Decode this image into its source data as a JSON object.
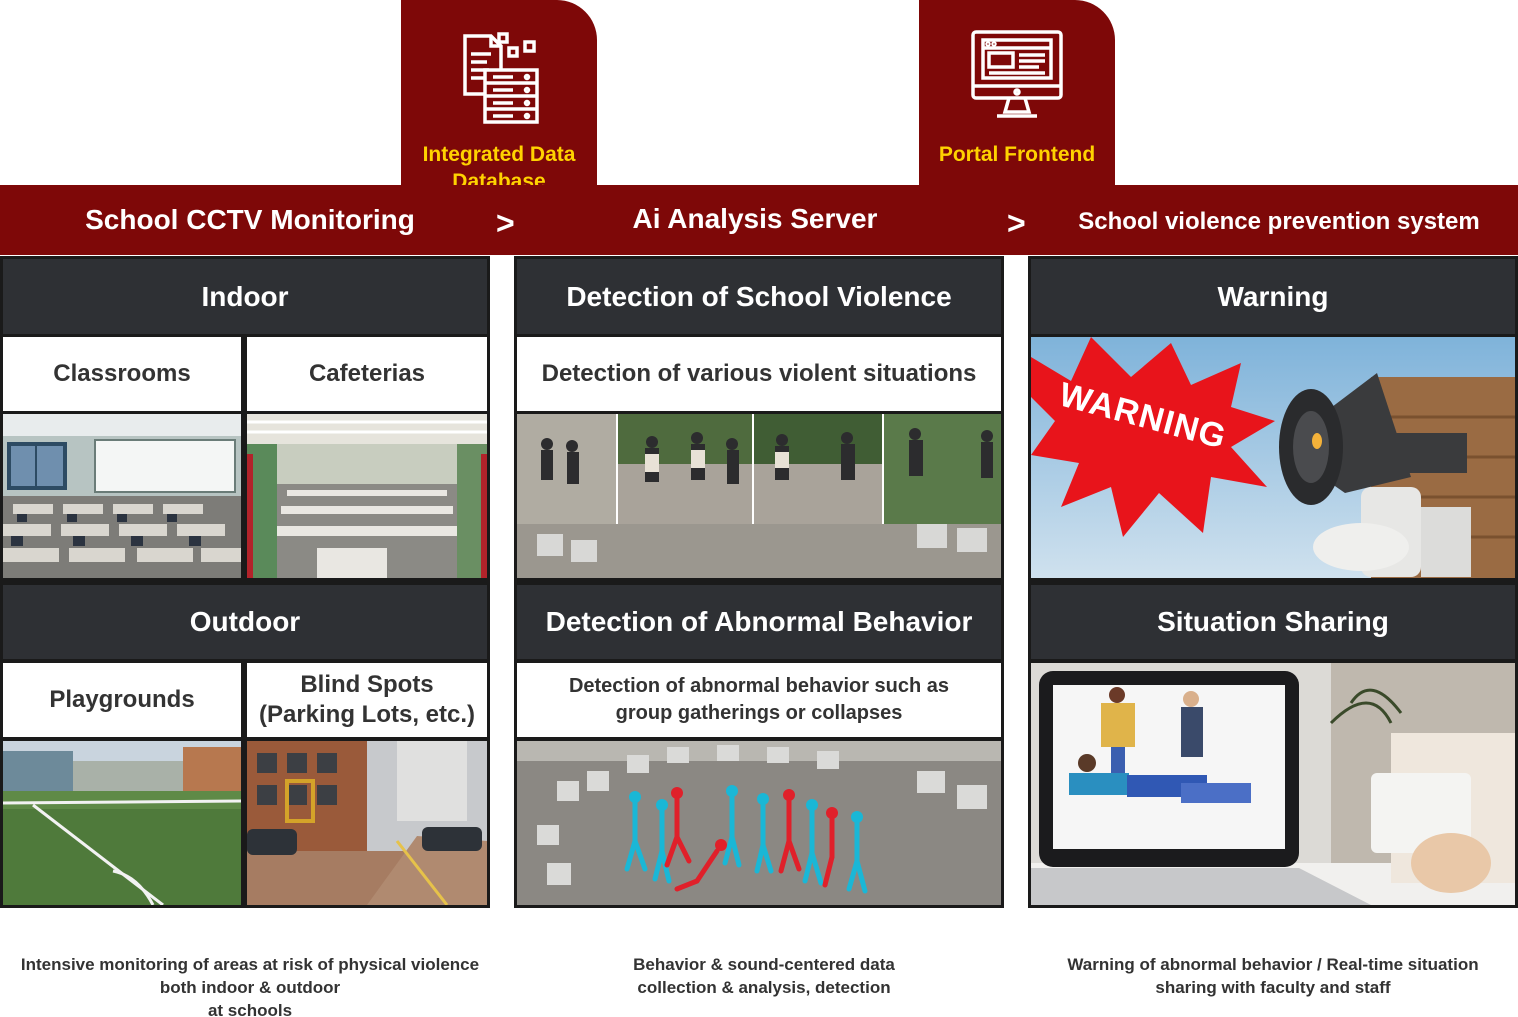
{
  "tabs": [
    {
      "label_line1": "Integrated Data",
      "label_line2": "Database",
      "icon": "database-document-icon"
    },
    {
      "label": "Portal Frontend",
      "icon": "monitor-icon"
    }
  ],
  "header": {
    "col1_title": "School CCTV Monitoring",
    "col2_title": "Ai Analysis Server",
    "col3_title": "School violence prevention system",
    "arrow": ">"
  },
  "col1": {
    "indoor": {
      "title": "Indoor",
      "items": [
        "Classrooms",
        "Cafeterias"
      ]
    },
    "outdoor": {
      "title": "Outdoor",
      "items": [
        "Playgrounds"
      ],
      "blind_line1": "Blind Spots",
      "blind_line2": "(Parking Lots, etc.)"
    },
    "caption_line1": "Intensive monitoring of areas at risk of physical violence",
    "caption_line2": "both indoor & outdoor",
    "caption_line3": "at schools"
  },
  "col2": {
    "violence": {
      "title": "Detection of School Violence",
      "desc": "Detection of various violent situations"
    },
    "abnormal": {
      "title": "Detection of Abnormal Behavior",
      "desc_line1": "Detection of abnormal behavior such as",
      "desc_line2": "group gatherings or collapses"
    },
    "caption_line1": "Behavior & sound-centered data",
    "caption_line2": "collection & analysis, detection"
  },
  "col3": {
    "warning": {
      "title": "Warning",
      "sign_text": "WARNING"
    },
    "sharing": {
      "title": "Situation Sharing"
    },
    "caption_line1": "Warning of abnormal behavior / Real-time situation",
    "caption_line2": "sharing with faculty and staff"
  },
  "colors": {
    "brand_red": "#7e0808",
    "tab_text": "#ffd200",
    "dark_header": "#2e3034",
    "warning_burst": "#e8141b"
  }
}
